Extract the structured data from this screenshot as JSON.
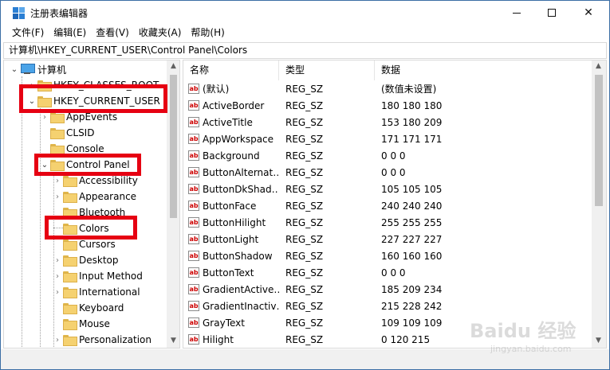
{
  "window": {
    "title": "注册表编辑器",
    "buttons": {
      "minimize": "—",
      "maximize": "□",
      "close": "✕"
    }
  },
  "menu": [
    "文件(F)",
    "编辑(E)",
    "查看(V)",
    "收藏夹(A)",
    "帮助(H)"
  ],
  "address": "计算机\\HKEY_CURRENT_USER\\Control Panel\\Colors",
  "tree": {
    "root": "计算机",
    "items": [
      {
        "label": "HKEY_CLASSES_ROOT",
        "level": 1,
        "expander": "closed"
      },
      {
        "label": "HKEY_CURRENT_USER",
        "level": 1,
        "expander": "open"
      },
      {
        "label": "AppEvents",
        "level": 2,
        "expander": "closed"
      },
      {
        "label": "CLSID",
        "level": 2,
        "expander": "none"
      },
      {
        "label": "Console",
        "level": 2,
        "expander": "none"
      },
      {
        "label": "Control Panel",
        "level": 2,
        "expander": "open"
      },
      {
        "label": "Accessibility",
        "level": 3,
        "expander": "closed"
      },
      {
        "label": "Appearance",
        "level": 3,
        "expander": "closed"
      },
      {
        "label": "Bluetooth",
        "level": 3,
        "expander": "none"
      },
      {
        "label": "Colors",
        "level": 3,
        "expander": "none"
      },
      {
        "label": "Cursors",
        "level": 3,
        "expander": "none"
      },
      {
        "label": "Desktop",
        "level": 3,
        "expander": "closed"
      },
      {
        "label": "Input Method",
        "level": 3,
        "expander": "closed"
      },
      {
        "label": "International",
        "level": 3,
        "expander": "closed"
      },
      {
        "label": "Keyboard",
        "level": 3,
        "expander": "none"
      },
      {
        "label": "Mouse",
        "level": 3,
        "expander": "none"
      },
      {
        "label": "Personalization",
        "level": 3,
        "expander": "closed"
      }
    ]
  },
  "list": {
    "headers": {
      "name": "名称",
      "type": "类型",
      "data": "数据"
    },
    "icon_text": "ab",
    "rows": [
      {
        "name": "(默认)",
        "type": "REG_SZ",
        "data": "(数值未设置)"
      },
      {
        "name": "ActiveBorder",
        "type": "REG_SZ",
        "data": "180 180 180"
      },
      {
        "name": "ActiveTitle",
        "type": "REG_SZ",
        "data": "153 180 209"
      },
      {
        "name": "AppWorkspace",
        "type": "REG_SZ",
        "data": "171 171 171"
      },
      {
        "name": "Background",
        "type": "REG_SZ",
        "data": "0 0 0"
      },
      {
        "name": "ButtonAlternat…",
        "type": "REG_SZ",
        "data": "0 0 0"
      },
      {
        "name": "ButtonDkShad…",
        "type": "REG_SZ",
        "data": "105 105 105"
      },
      {
        "name": "ButtonFace",
        "type": "REG_SZ",
        "data": "240 240 240"
      },
      {
        "name": "ButtonHilight",
        "type": "REG_SZ",
        "data": "255 255 255"
      },
      {
        "name": "ButtonLight",
        "type": "REG_SZ",
        "data": "227 227 227"
      },
      {
        "name": "ButtonShadow",
        "type": "REG_SZ",
        "data": "160 160 160"
      },
      {
        "name": "ButtonText",
        "type": "REG_SZ",
        "data": "0 0 0"
      },
      {
        "name": "GradientActive…",
        "type": "REG_SZ",
        "data": "185 209 234"
      },
      {
        "name": "GradientInactiv…",
        "type": "REG_SZ",
        "data": "215 228 242"
      },
      {
        "name": "GrayText",
        "type": "REG_SZ",
        "data": "109 109 109"
      },
      {
        "name": "Hilight",
        "type": "REG_SZ",
        "data": "0 120 215"
      }
    ]
  },
  "colors": {
    "highlight_box": "#e60012",
    "accent": "#0078d7"
  },
  "watermark": {
    "main": "Baidu 经验",
    "sub": "jingyan.baidu.com"
  }
}
